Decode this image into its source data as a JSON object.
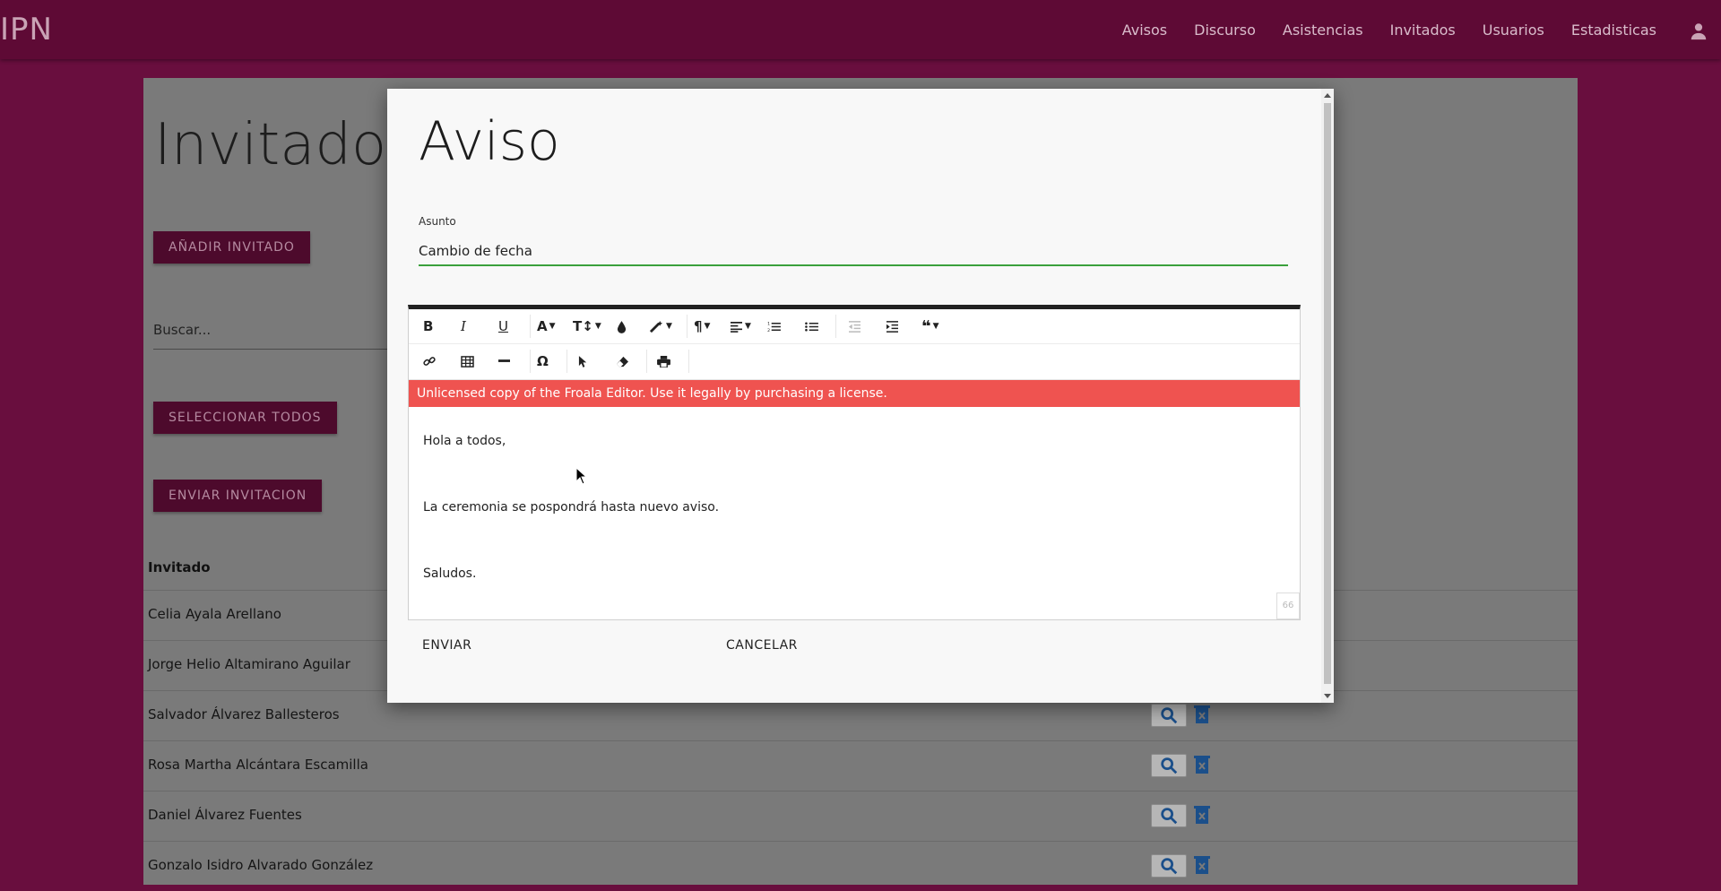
{
  "navbar": {
    "brand": "IPN",
    "links": [
      "Avisos",
      "Discurso",
      "Asistencias",
      "Invitados",
      "Usuarios",
      "Estadisticas"
    ],
    "user_icon": "person-icon"
  },
  "page": {
    "title": "Invitados",
    "add_button": "AÑADIR INVITADO",
    "search_placeholder": "Buscar...",
    "select_all_button": "SELECCIONAR TODOS",
    "send_invitation_button": "ENVIAR INVITACION",
    "column_header": "Invitado",
    "rows": [
      "Celia Ayala Arellano",
      "Jorge Helio Altamirano Aguilar",
      "Salvador Álvarez Ballesteros",
      "Rosa Martha Alcántara Escamilla",
      "Daniel Álvarez Fuentes",
      "Gonzalo Isidro Alvarado González"
    ]
  },
  "modal": {
    "title": "Aviso",
    "subject_label": "Asunto",
    "subject_value": "Cambio de fecha",
    "license_notice": "Unlicensed copy of the Froala Editor. Use it legally by purchasing a license.",
    "body": {
      "line1": "Hola a todos,",
      "line2": "La ceremonia se pospondrá hasta nuevo aviso.",
      "line3": "Saludos."
    },
    "char_count": "66",
    "send_button": "ENVIAR",
    "cancel_button": "CANCELAR"
  },
  "colors": {
    "navbar": "#5e0a35",
    "background": "#690e3e",
    "button": "#4d0a2c",
    "license_bar": "#ef5350",
    "input_underline": "#3aa03c"
  }
}
